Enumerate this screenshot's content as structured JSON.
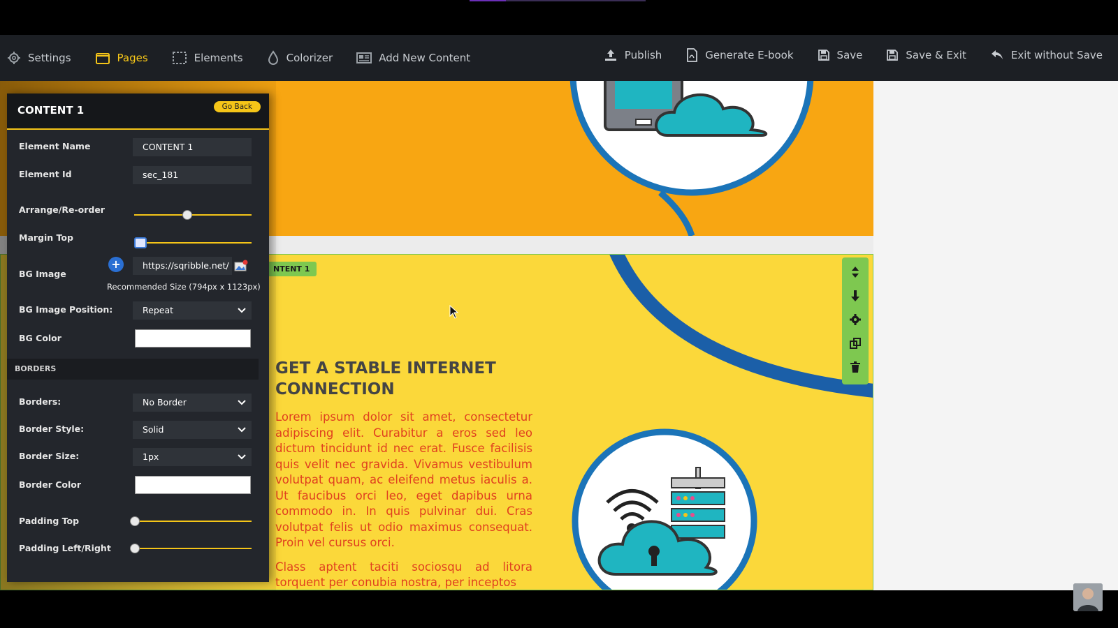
{
  "toolbar": {
    "left": [
      {
        "label": "Settings",
        "icon": "gear-icon",
        "active": false
      },
      {
        "label": "Pages",
        "icon": "folder-icon",
        "active": true
      },
      {
        "label": "Elements",
        "icon": "selection-icon",
        "active": false
      },
      {
        "label": "Colorizer",
        "icon": "drop-icon",
        "active": false
      },
      {
        "label": "Add New Content",
        "icon": "add-content-icon",
        "active": false
      }
    ],
    "right": [
      {
        "label": "Publish",
        "icon": "upload-icon"
      },
      {
        "label": "Generate E-book",
        "icon": "pdf-icon"
      },
      {
        "label": "Save",
        "icon": "save-icon"
      },
      {
        "label": "Save & Exit",
        "icon": "save-icon"
      },
      {
        "label": "Exit without Save",
        "icon": "undo-icon"
      }
    ]
  },
  "panel": {
    "title": "CONTENT 1",
    "go_back": "Go Back",
    "element_name_label": "Element Name",
    "element_name_value": "CONTENT 1",
    "element_id_label": "Element Id",
    "element_id_value": "sec_181",
    "arrange_label": "Arrange/Re-order",
    "margin_top_label": "Margin Top",
    "bg_image_label": "BG Image",
    "bg_image_value": "https://sqribble.net/",
    "recommended_size": "Recommended Size (794px x 1123px)",
    "bg_image_position_label": "BG Image Position:",
    "bg_image_position_value": "Repeat",
    "bg_color_label": "BG Color",
    "borders_section": "BORDERS",
    "borders_label": "Borders:",
    "borders_value": "No Border",
    "border_style_label": "Border Style:",
    "border_style_value": "Solid",
    "border_size_label": "Border Size:",
    "border_size_value": "1px",
    "border_color_label": "Border Color",
    "padding_top_label": "Padding Top",
    "padding_lr_label": "Padding Left/Right",
    "sliders": {
      "arrange": 0.45,
      "margin_top": 0.0,
      "padding_top": 0.0,
      "padding_lr": 0.0
    }
  },
  "content": {
    "badge": "NTENT 1",
    "headline": "GET A STABLE INTERNET CONNECTION",
    "paragraph1": "Lorem ipsum dolor sit amet, consectetur adipiscing elit. Curabitur a eros sed leo dictum tincidunt id nec erat. Fusce facilisis quis velit nec gravida. Vivamus vestibulum volutpat quam, ac eleifend metus iaculis a. Ut faucibus orci leo, eget dapibus urna commodo in. In quis pulvinar dui. Cras volutpat felis ut odio maximus consequat. Proin vel cursus orci.",
    "paragraph2": "Class aptent taciti sociosqu ad litora torquent per conubia nostra, per inceptos"
  },
  "colors": {
    "accent": "#f5c518",
    "orange_section": "#f8a612",
    "yellow_section": "#fbd83a",
    "text_red": "#e0401f",
    "tool_green": "#7ec850",
    "circle_blue": "#1b74b8"
  }
}
